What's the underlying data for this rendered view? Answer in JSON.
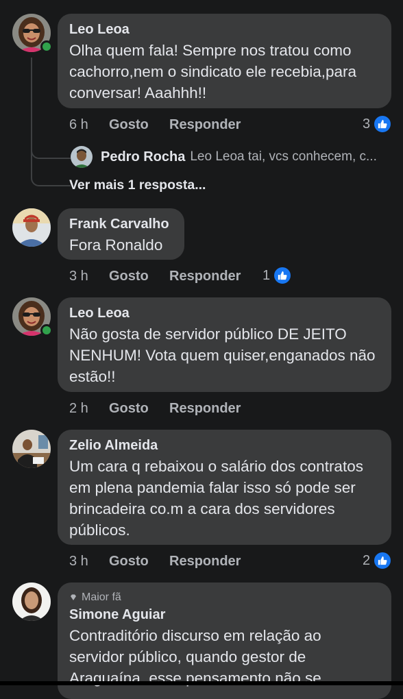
{
  "comments": [
    {
      "author": "Leo Leoa",
      "text": "Olha quem fala! Sempre nos tratou como cachorro,nem o sindicato ele recebia,para conversar! Aaahhh!!",
      "time": "6 h",
      "like_label": "Gosto",
      "reply_label": "Responder",
      "reaction_count": "3",
      "online": true,
      "reply_preview": {
        "author": "Pedro Rocha",
        "text": "Leo Leoa tai, vcs conhecem, c..."
      },
      "more_replies": "Ver mais 1 resposta..."
    },
    {
      "author": "Frank Carvalho",
      "text": "Fora Ronaldo",
      "time": "3 h",
      "like_label": "Gosto",
      "reply_label": "Responder",
      "reaction_count": "1"
    },
    {
      "author": "Leo Leoa",
      "text": "Não gosta de servidor público DE JEITO NENHUM! Vota quem quiser,enganados não estão!!",
      "time": "2 h",
      "like_label": "Gosto",
      "reply_label": "Responder",
      "online": true
    },
    {
      "author": "Zelio Almeida",
      "text": "Um cara q rebaixou o salário dos contratos em plena pandemia falar isso só pode ser brincadeira co.m a cara dos servidores públicos.",
      "time": "3 h",
      "like_label": "Gosto",
      "reply_label": "Responder",
      "reaction_count": "2"
    },
    {
      "author": "Simone Aguiar",
      "badge": "Maior fã",
      "text": "Contraditório discurso em relação ao servidor público, quando gestor de Araguaína, esse pensamento não se"
    }
  ],
  "icons": {
    "reaction": "like-icon",
    "badge": "diamond-icon"
  },
  "colors": {
    "background": "#18191a",
    "bubble": "#3a3b3c",
    "like_blue": "#1877f2",
    "online_green": "#31a24c"
  }
}
